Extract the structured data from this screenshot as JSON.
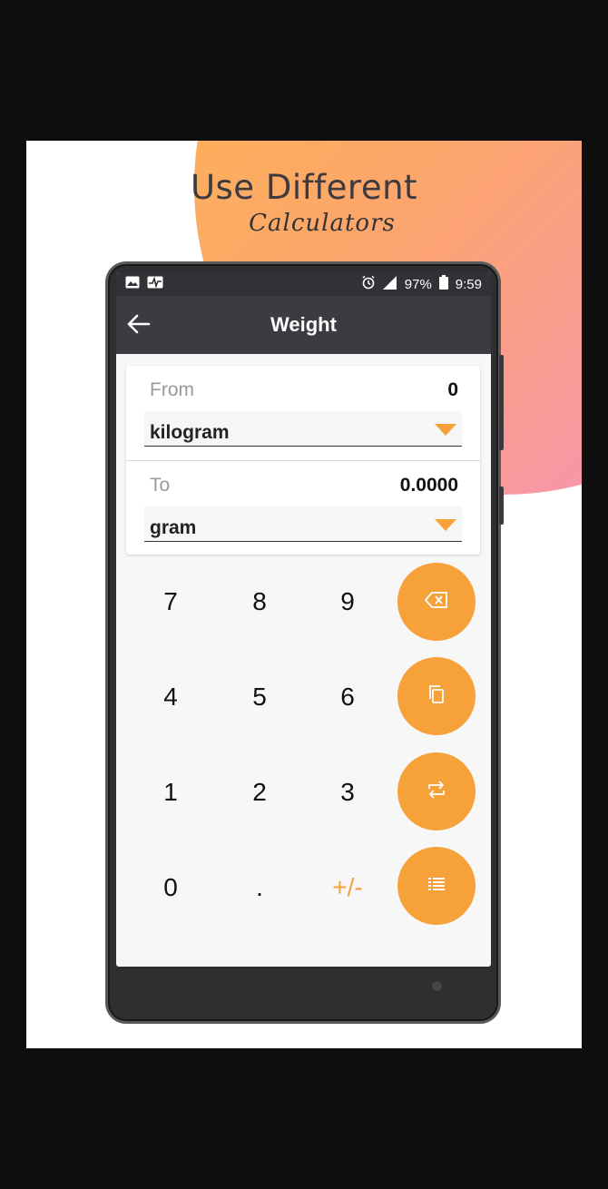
{
  "promo": {
    "headline": "Use Different",
    "subline": "Calculators"
  },
  "statusbar": {
    "battery": "97%",
    "time": "9:59"
  },
  "appbar": {
    "title": "Weight"
  },
  "converter": {
    "from": {
      "label": "From",
      "value": "0",
      "unit": "kilogram"
    },
    "to": {
      "label": "To",
      "value": "0.0000",
      "unit": "gram"
    }
  },
  "keypad": {
    "rows": [
      [
        "7",
        "8",
        "9"
      ],
      [
        "4",
        "5",
        "6"
      ],
      [
        "1",
        "2",
        "3"
      ],
      [
        "0",
        ".",
        "+/-"
      ]
    ],
    "actions": [
      "backspace-icon",
      "copy-icon",
      "swap-icon",
      "list-icon"
    ]
  },
  "colors": {
    "accent": "#f7a13a",
    "appbar": "#3a3c41",
    "statusbar": "#313236"
  }
}
